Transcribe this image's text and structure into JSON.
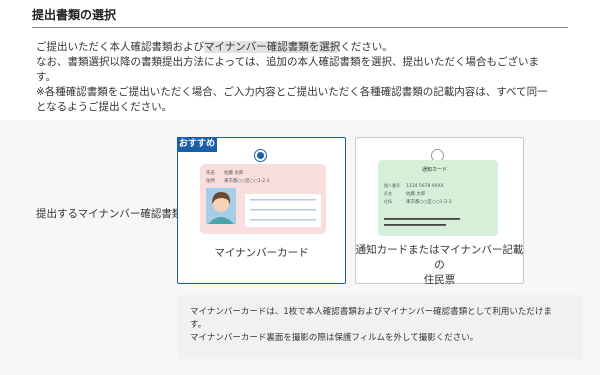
{
  "page": {
    "title": "提出書類の選択",
    "intro": {
      "line1_pre": "ご提出いただく本人確認書類および",
      "line1_hl": "マイナンバー確認書類を選択",
      "line1_post": "ください。",
      "line2": "なお、書類選択以降の書類提出方法によっては、追加の本人確認書類を選択、提出いただく場合もございま",
      "line3": "す。",
      "line4": "※各種確認書類をご提出いただく場合、ご入力内容とご提出いただく各種確認書類の記載内容は、すべて同一",
      "line5": "となるようご提出ください。"
    },
    "row_label": "提出するマイナンバー確認書類",
    "options": [
      {
        "badge": "おすすめ",
        "selected": true,
        "label": "マイナンバーカード",
        "card": {
          "field1": "氏名",
          "value1": "佐藤 太郎",
          "field2": "住所",
          "value2": "東京都○○区○○1-2-3"
        }
      },
      {
        "selected": false,
        "label_line1": "通知カードまたはマイナンバー記載の",
        "label_line2": "住民票",
        "card": {
          "header": "通知カード",
          "field1": "個人番号",
          "value1": "1234 5678 9XXX",
          "field2": "氏名",
          "value2": "佐藤 太郎",
          "field3": "住所",
          "value3": "東京都○○区○○1-2-3"
        }
      }
    ],
    "note": {
      "line1": "マイナンバーカードは、1枚で本人確認書類およびマイナンバー確認書類として利用いただけま",
      "line2": "す。",
      "line3": "マイナンバーカード裏面を撮影の際は保護フィルムを外して撮影ください。"
    },
    "colors": {
      "accent": "#1a5fa8",
      "card_pink": "#f9dede",
      "card_green": "#d6efd9"
    }
  }
}
